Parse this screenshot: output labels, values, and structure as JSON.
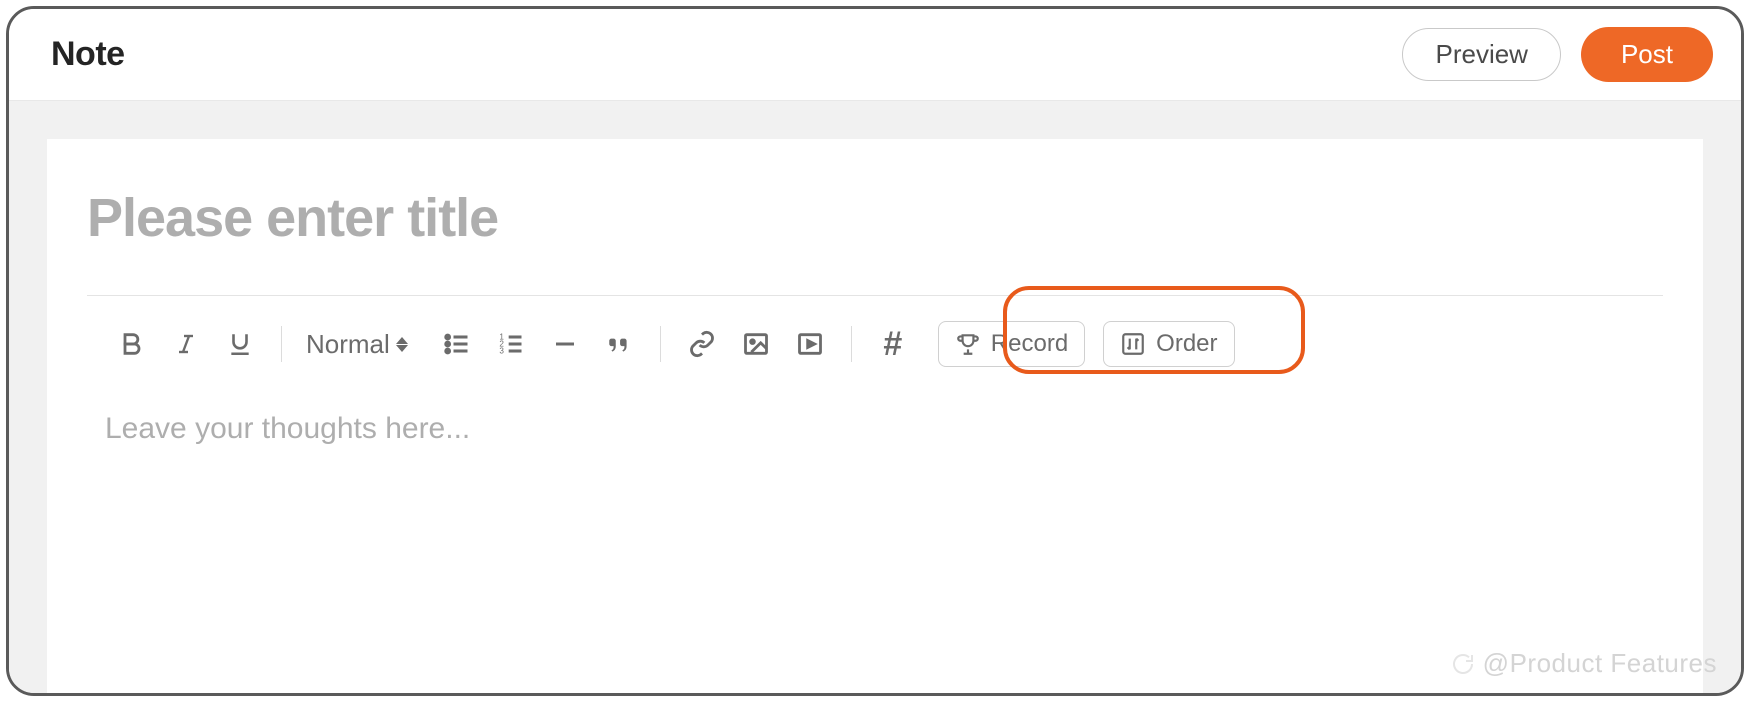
{
  "header": {
    "title": "Note",
    "preview_label": "Preview",
    "post_label": "Post"
  },
  "editor": {
    "title_placeholder": "Please enter title",
    "body_placeholder": "Leave your thoughts here..."
  },
  "toolbar": {
    "format_label": "Normal",
    "record_label": "Record",
    "order_label": "Order"
  },
  "watermark": {
    "text": "@Product Features"
  }
}
